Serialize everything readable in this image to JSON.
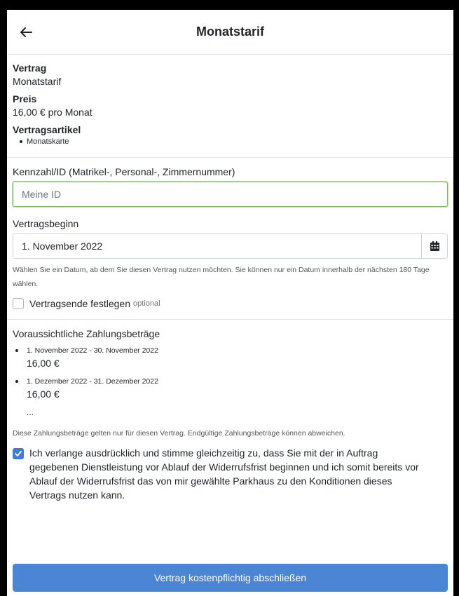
{
  "header": {
    "title": "Monatstarif",
    "back_icon": "arrow-left-icon"
  },
  "contract": {
    "vertrag_label": "Vertrag",
    "vertrag_value": "Monatstarif",
    "preis_label": "Preis",
    "preis_value": "16,00 € pro Monat",
    "artikel_label": "Vertragsartikel",
    "artikel_items": [
      "Monatskarte"
    ]
  },
  "form": {
    "id_label": "Kennzahl/ID (Matrikel-, Personal-, Zimmernummer)",
    "id_placeholder": "Meine ID",
    "id_value": "",
    "start_label": "Vertragsbeginn",
    "start_value": "1. November 2022",
    "start_help": "Wählen Sie ein Datum, ab dem Sie diesen Vertrag nutzen möchten. Sie können nur ein Datum innerhalb der nächsten 180 Tage wählen.",
    "end_checkbox_label": "Vertragsende festlegen",
    "end_checkbox_optional": "optional",
    "end_checked": false
  },
  "payments": {
    "title": "Voraussichtliche Zahlungsbeträge",
    "items": [
      {
        "range": "1. November 2022 - 30. November 2022",
        "amount": "16,00 €"
      },
      {
        "range": "1. Dezember 2022 - 31. Dezember 2022",
        "amount": "16,00 €"
      }
    ],
    "more": "...",
    "note": "Diese Zahlungsbeträge gelten nur für diesen Vertrag. Endgültige Zahlungsbeträge können abweichen."
  },
  "consent": {
    "checked": true,
    "text": "Ich verlange ausdrücklich und stimme gleichzeitig zu, dass Sie mit der in Auftrag gegebenen Dienstleistung vor Ablauf der Widerrufsfrist beginnen und ich somit bereits vor Ablauf der Widerrufsfrist das von mir gewählte Parkhaus zu den Konditionen dieses Vertrags nutzen kann."
  },
  "submit_label": "Vertrag kostenpflichtig abschließen",
  "colors": {
    "primary": "#4a86d4",
    "focus": "#7cbf5d"
  }
}
